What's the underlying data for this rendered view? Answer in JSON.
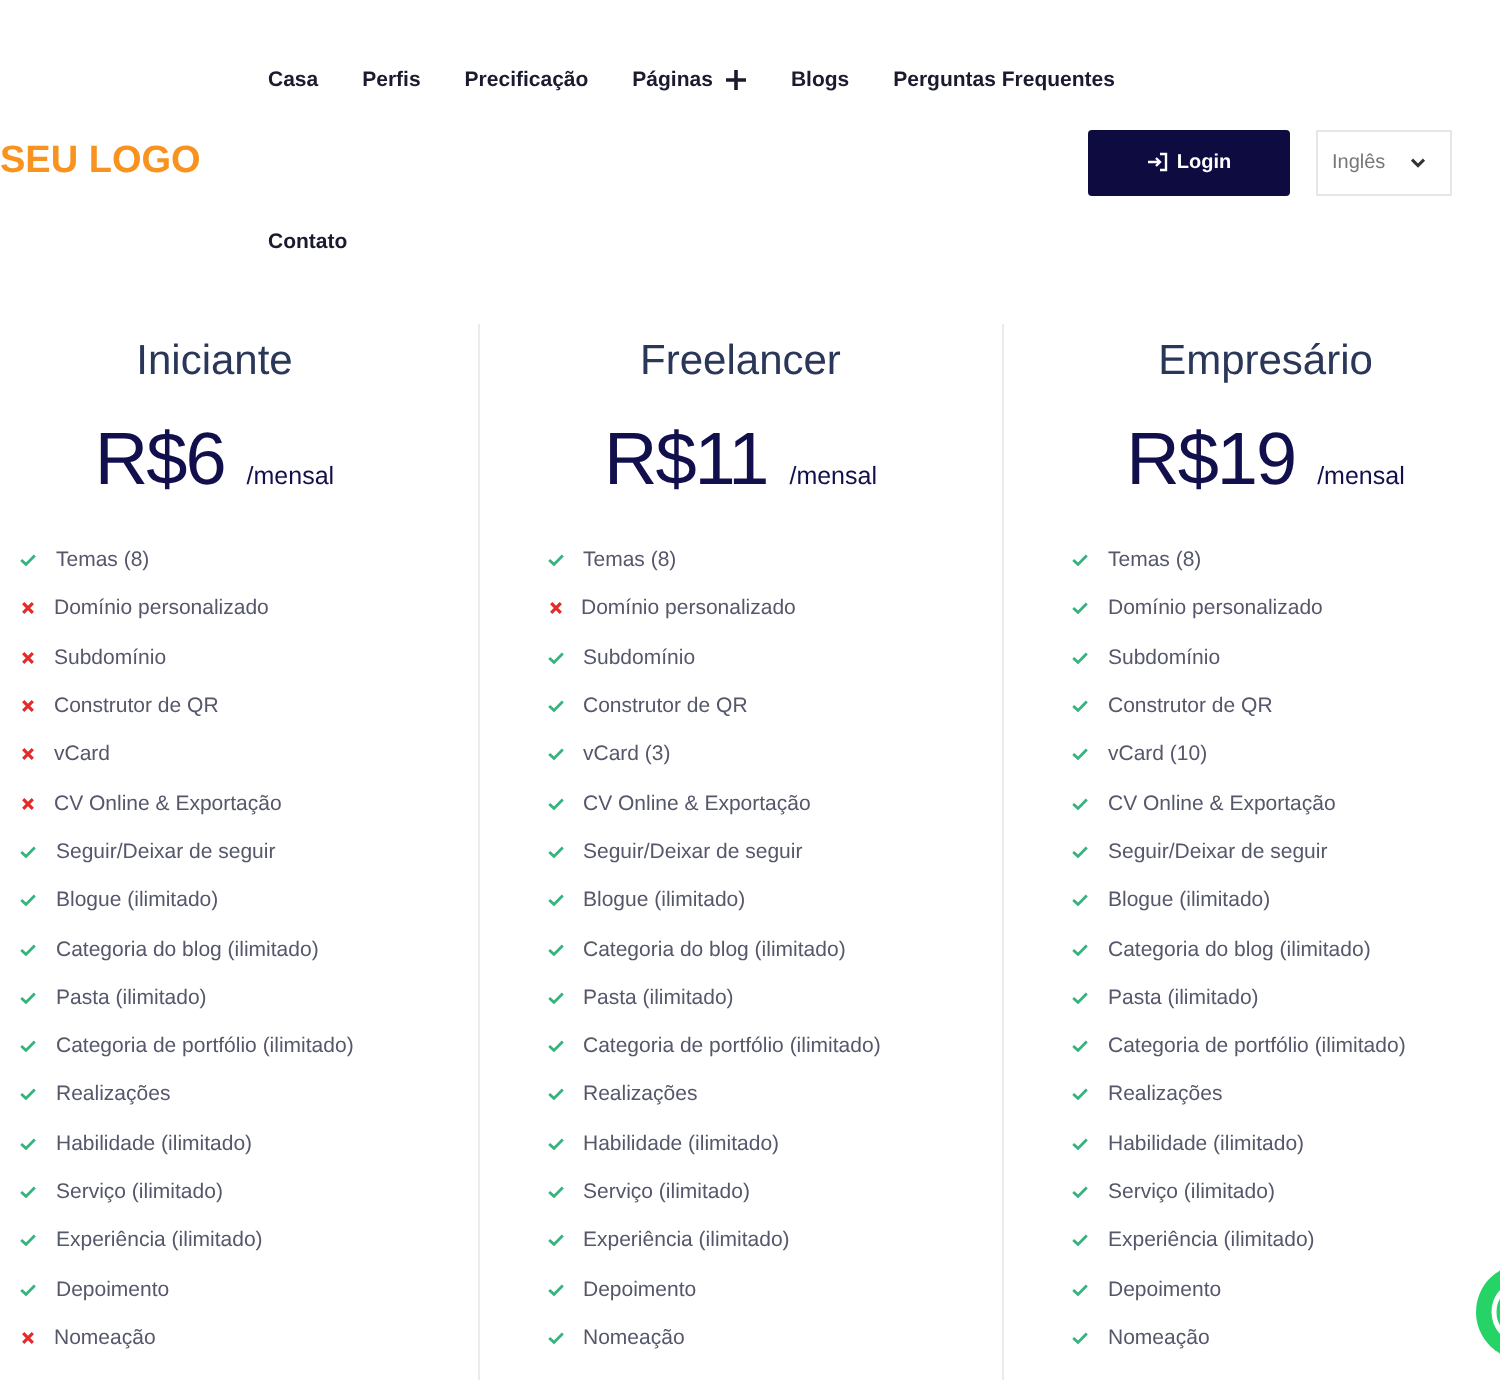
{
  "logo": {
    "text": "SEU LOGO"
  },
  "nav": [
    {
      "label": "Casa",
      "expandable": false
    },
    {
      "label": "Perfis",
      "expandable": false
    },
    {
      "label": "Precificação",
      "expandable": false
    },
    {
      "label": "Páginas",
      "expandable": true
    },
    {
      "label": "Blogs",
      "expandable": false
    },
    {
      "label": "Perguntas Frequentes",
      "expandable": false
    },
    {
      "label": "Contato",
      "expandable": false
    }
  ],
  "login_button": {
    "label": "Login"
  },
  "language_select": {
    "value": "Inglês"
  },
  "plans": [
    {
      "name": "Iniciante",
      "price": "R$6",
      "period": "/mensal",
      "features": [
        {
          "text": "Temas (8)",
          "included": true
        },
        {
          "text": "Domínio personalizado",
          "included": false
        },
        {
          "text": "Subdomínio",
          "included": false
        },
        {
          "text": "Construtor de QR",
          "included": false
        },
        {
          "text": "vCard",
          "included": false
        },
        {
          "text": "CV Online & Exportação",
          "included": false
        },
        {
          "text": "Seguir/Deixar de seguir",
          "included": true
        },
        {
          "text": "Blogue (ilimitado)",
          "included": true
        },
        {
          "text": "Categoria do blog (ilimitado)",
          "included": true
        },
        {
          "text": "Pasta (ilimitado)",
          "included": true
        },
        {
          "text": "Categoria de portfólio (ilimitado)",
          "included": true
        },
        {
          "text": "Realizações",
          "included": true
        },
        {
          "text": "Habilidade (ilimitado)",
          "included": true
        },
        {
          "text": "Serviço (ilimitado)",
          "included": true
        },
        {
          "text": "Experiência (ilimitado)",
          "included": true
        },
        {
          "text": "Depoimento",
          "included": true
        },
        {
          "text": "Nomeação",
          "included": false
        }
      ]
    },
    {
      "name": "Freelancer",
      "price": "R$11",
      "period": "/mensal",
      "features": [
        {
          "text": "Temas (8)",
          "included": true
        },
        {
          "text": "Domínio personalizado",
          "included": false
        },
        {
          "text": "Subdomínio",
          "included": true
        },
        {
          "text": "Construtor de QR",
          "included": true
        },
        {
          "text": "vCard (3)",
          "included": true
        },
        {
          "text": "CV Online & Exportação",
          "included": true
        },
        {
          "text": "Seguir/Deixar de seguir",
          "included": true
        },
        {
          "text": "Blogue (ilimitado)",
          "included": true
        },
        {
          "text": "Categoria do blog (ilimitado)",
          "included": true
        },
        {
          "text": "Pasta (ilimitado)",
          "included": true
        },
        {
          "text": "Categoria de portfólio (ilimitado)",
          "included": true
        },
        {
          "text": "Realizações",
          "included": true
        },
        {
          "text": "Habilidade (ilimitado)",
          "included": true
        },
        {
          "text": "Serviço (ilimitado)",
          "included": true
        },
        {
          "text": "Experiência (ilimitado)",
          "included": true
        },
        {
          "text": "Depoimento",
          "included": true
        },
        {
          "text": "Nomeação",
          "included": true
        }
      ]
    },
    {
      "name": "Empresário",
      "price": "R$19",
      "period": "/mensal",
      "features": [
        {
          "text": "Temas (8)",
          "included": true
        },
        {
          "text": "Domínio personalizado",
          "included": true
        },
        {
          "text": "Subdomínio",
          "included": true
        },
        {
          "text": "Construtor de QR",
          "included": true
        },
        {
          "text": "vCard (10)",
          "included": true
        },
        {
          "text": "CV Online & Exportação",
          "included": true
        },
        {
          "text": "Seguir/Deixar de seguir",
          "included": true
        },
        {
          "text": "Blogue (ilimitado)",
          "included": true
        },
        {
          "text": "Categoria do blog (ilimitado)",
          "included": true
        },
        {
          "text": "Pasta (ilimitado)",
          "included": true
        },
        {
          "text": "Categoria de portfólio (ilimitado)",
          "included": true
        },
        {
          "text": "Realizações",
          "included": true
        },
        {
          "text": "Habilidade (ilimitado)",
          "included": true
        },
        {
          "text": "Serviço (ilimitado)",
          "included": true
        },
        {
          "text": "Experiência (ilimitado)",
          "included": true
        },
        {
          "text": "Depoimento",
          "included": true
        },
        {
          "text": "Nomeação",
          "included": true
        }
      ]
    }
  ]
}
